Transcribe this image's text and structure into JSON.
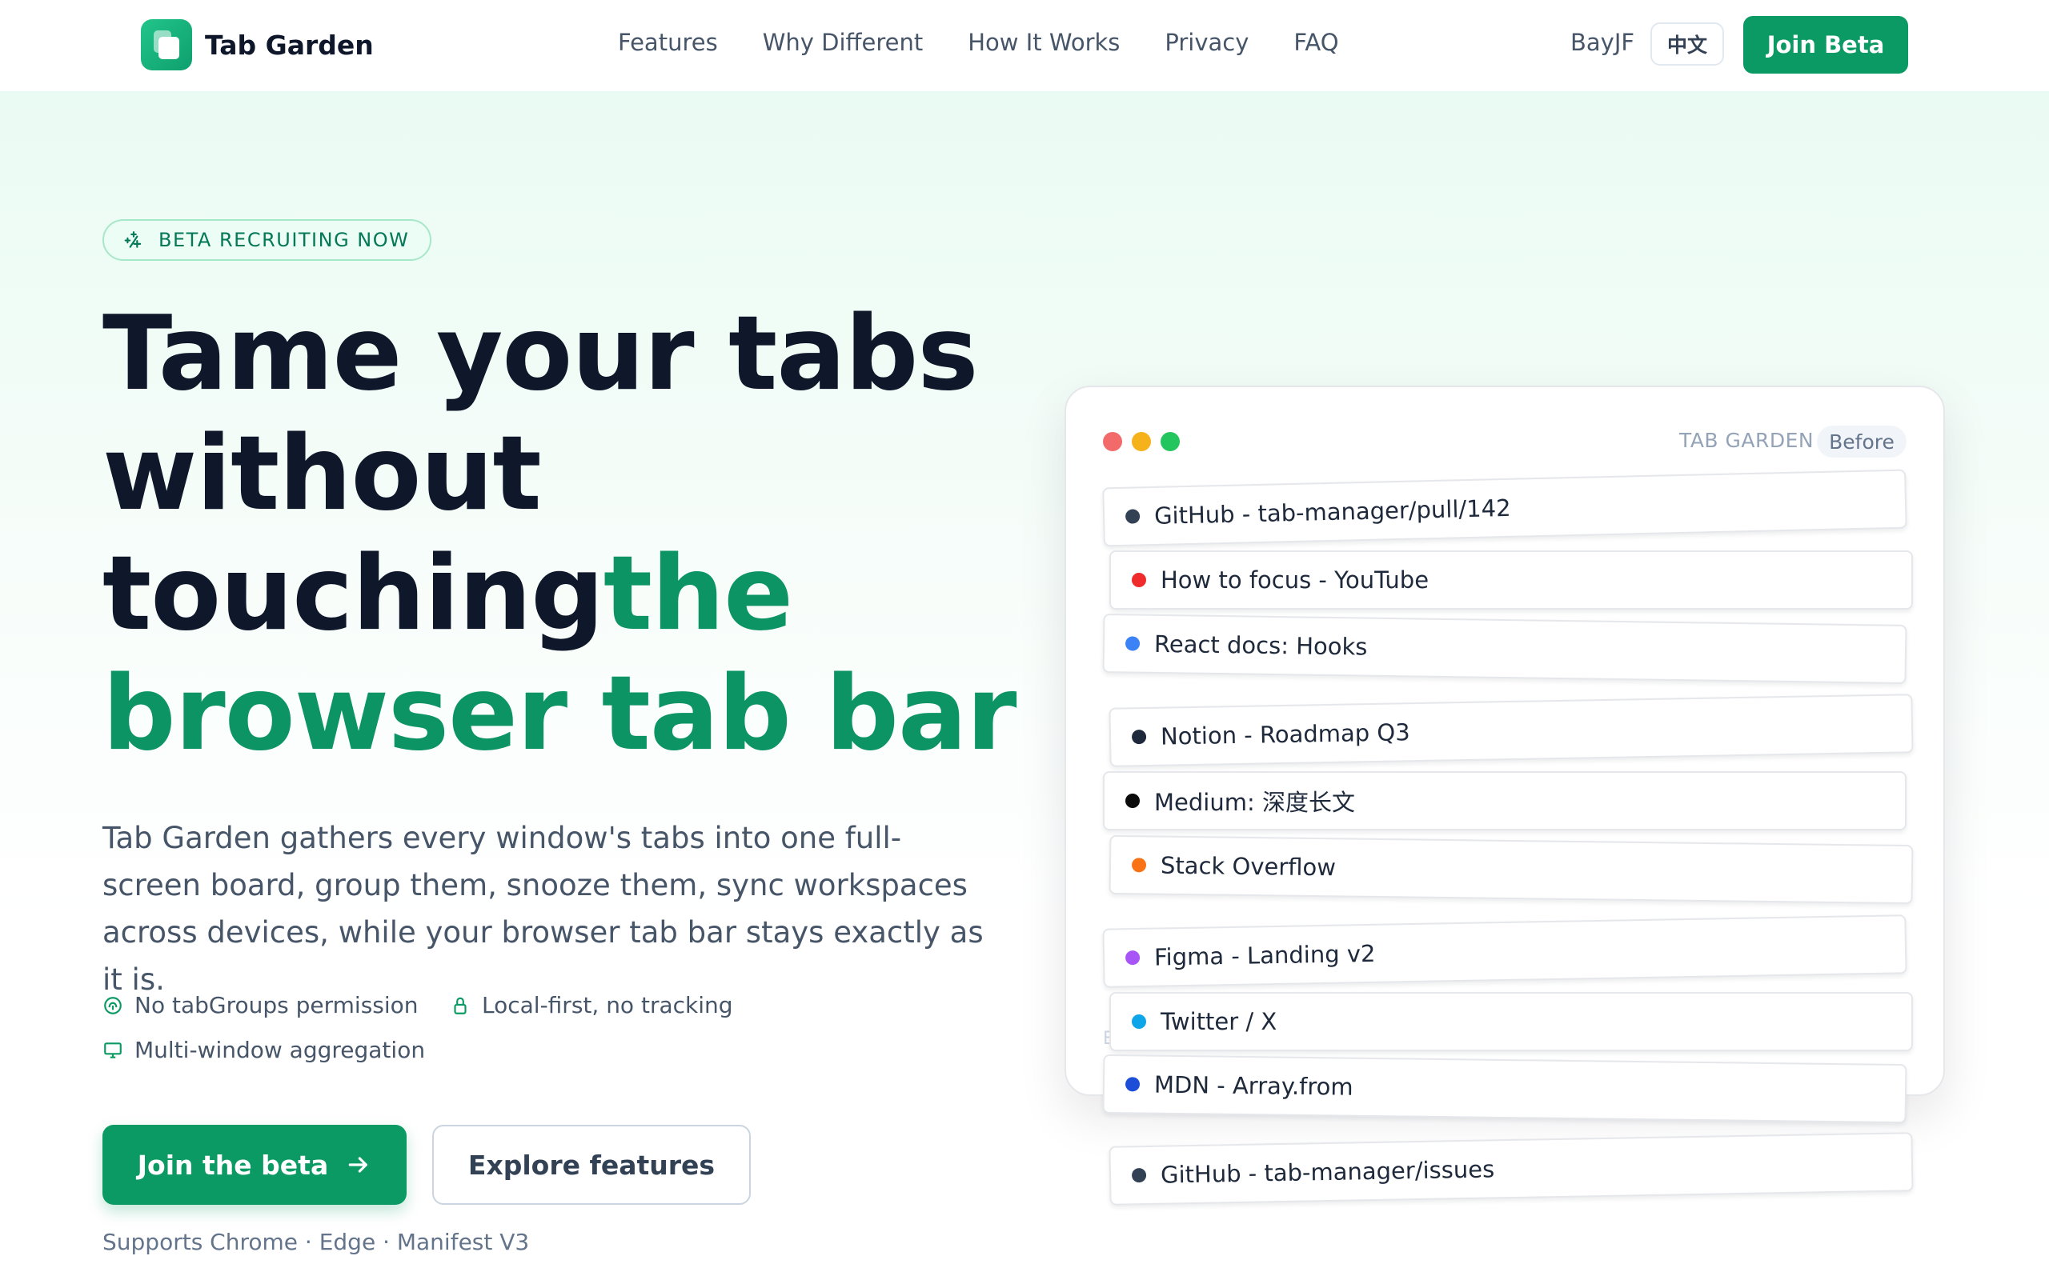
{
  "header": {
    "brand": "Tab Garden",
    "nav": [
      "Features",
      "Why Different",
      "How It Works",
      "Privacy",
      "FAQ"
    ],
    "user": "BayJF",
    "language_button": "中文",
    "join_button": "Join Beta"
  },
  "hero": {
    "badge": "BETA RECRUITING NOW",
    "headline": {
      "part1": "Tame your tabs without touching",
      "accent": "the browser tab bar"
    },
    "subtitle": "Tab Garden gathers every window's tabs into one full-screen board, group them, snooze them, sync workspaces across devices, while your browser tab bar stays exactly as it is.",
    "features": [
      "No tabGroups permission",
      "Local-first, no tracking",
      "Multi-window aggregation"
    ],
    "cta_primary": "Join the beta",
    "cta_secondary": "Explore features",
    "supports": "Supports Chrome · Edge · Manifest V3"
  },
  "mock": {
    "title": "TAB GARDEN",
    "state": "Before",
    "ghost_label": "E",
    "tabs": [
      {
        "label": "GitHub - tab-manager/pull/142",
        "color": "#334155"
      },
      {
        "label": "How to focus - YouTube",
        "color": "#ef2b2b"
      },
      {
        "label": "React docs: Hooks",
        "color": "#3b82f6"
      },
      {
        "label": "Notion - Roadmap Q3",
        "color": "#1e293b"
      },
      {
        "label": "Medium: 深度长文",
        "color": "#0b0b0b"
      },
      {
        "label": "Stack Overflow",
        "color": "#f97316"
      },
      {
        "label": "Figma - Landing v2",
        "color": "#a855f7"
      },
      {
        "label": "Twitter / X",
        "color": "#0ea5e9"
      },
      {
        "label": "MDN - Array.from",
        "color": "#1d4ed8"
      },
      {
        "label": "GitHub - tab-manager/issues",
        "color": "#334155"
      }
    ]
  },
  "colors": {
    "brand": "#0c9a64",
    "traffic_red": "#f26a6a",
    "traffic_yellow": "#f5b21b",
    "traffic_green": "#22c55e"
  }
}
